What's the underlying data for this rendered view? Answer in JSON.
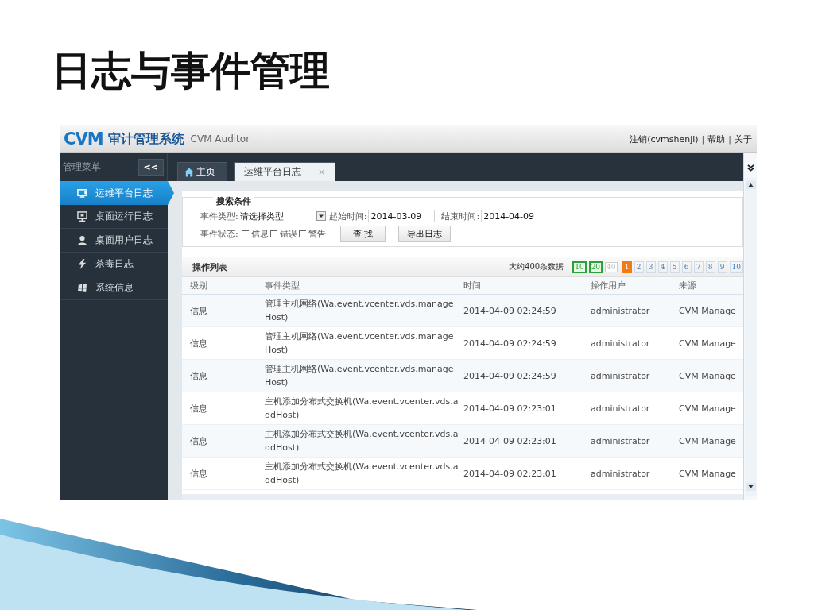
{
  "slide_title": "日志与事件管理",
  "header": {
    "logo": "CVM",
    "title": "审计管理系统",
    "subtitle": "CVM Auditor",
    "links": [
      {
        "kind": "link",
        "text": "注销(cvmshenji)"
      },
      {
        "kind": "separator",
        "text": "|"
      },
      {
        "kind": "link",
        "text": "帮助"
      },
      {
        "kind": "separator",
        "text": "|"
      },
      {
        "kind": "link",
        "text": "关于"
      }
    ]
  },
  "sidebar": {
    "title": "管理菜单",
    "collapse": "<<",
    "items": [
      {
        "label": "运维平台日志",
        "selected": true
      },
      {
        "label": "桌面运行日志",
        "selected": false
      },
      {
        "label": "桌面用户日志",
        "selected": false
      },
      {
        "label": "杀毒日志",
        "selected": false
      },
      {
        "label": "系统信息",
        "selected": false
      }
    ]
  },
  "tabs": [
    {
      "label": "主页",
      "selected": false
    },
    {
      "label": "运维平台日志",
      "selected": true,
      "close": "×"
    }
  ],
  "search": {
    "legend": "搜索条件",
    "event_type_label": "事件类型:",
    "event_type_value": "请选择类型",
    "start_label": "起始时间:",
    "start_value": "2014-03-09",
    "end_label": "结束时间:",
    "end_value": "2014-04-09",
    "status_label": "事件状态:",
    "statuses": [
      {
        "label": "信息",
        "checked": false
      },
      {
        "label": "错误",
        "checked": false
      },
      {
        "label": "警告",
        "checked": false
      }
    ],
    "buttons": [
      "查 找",
      "导出日志"
    ]
  },
  "table": {
    "title": "操作列表",
    "count": "大约400条数据",
    "page_sizes": [
      {
        "label": "10",
        "enabled": true
      },
      {
        "label": "20",
        "enabled": true
      },
      {
        "label": "40",
        "enabled": false
      }
    ],
    "pages": [
      {
        "label": "1",
        "selected": true
      },
      {
        "label": "2",
        "selected": false
      },
      {
        "label": "3",
        "selected": false
      },
      {
        "label": "4",
        "selected": false
      },
      {
        "label": "5",
        "selected": false
      },
      {
        "label": "6",
        "selected": false
      },
      {
        "label": "7",
        "selected": false
      },
      {
        "label": "8",
        "selected": false
      },
      {
        "label": "9",
        "selected": false
      },
      {
        "label": "10",
        "selected": false
      }
    ],
    "columns": [
      "级别",
      "事件类型",
      "时间",
      "操作用户",
      "来源"
    ],
    "rows": [
      [
        "信息",
        "管理主机网络(Wa.event.vcenter.vds.manageHost)",
        "2014-04-09 02:24:59",
        "administrator",
        "CVM Manage"
      ],
      [
        "信息",
        "管理主机网络(Wa.event.vcenter.vds.manageHost)",
        "2014-04-09 02:24:59",
        "administrator",
        "CVM Manage"
      ],
      [
        "信息",
        "管理主机网络(Wa.event.vcenter.vds.manageHost)",
        "2014-04-09 02:24:59",
        "administrator",
        "CVM Manage"
      ],
      [
        "信息",
        "主机添加分布式交换机(Wa.event.vcenter.vds.addHost)",
        "2014-04-09 02:23:01",
        "administrator",
        "CVM Manage"
      ],
      [
        "信息",
        "主机添加分布式交换机(Wa.event.vcenter.vds.addHost)",
        "2014-04-09 02:23:01",
        "administrator",
        "CVM Manage"
      ],
      [
        "信息",
        "主机添加分布式交换机(Wa.event.vcenter.vds.addHost)",
        "2014-04-09 02:23:01",
        "administrator",
        "CVM Manage"
      ]
    ]
  }
}
